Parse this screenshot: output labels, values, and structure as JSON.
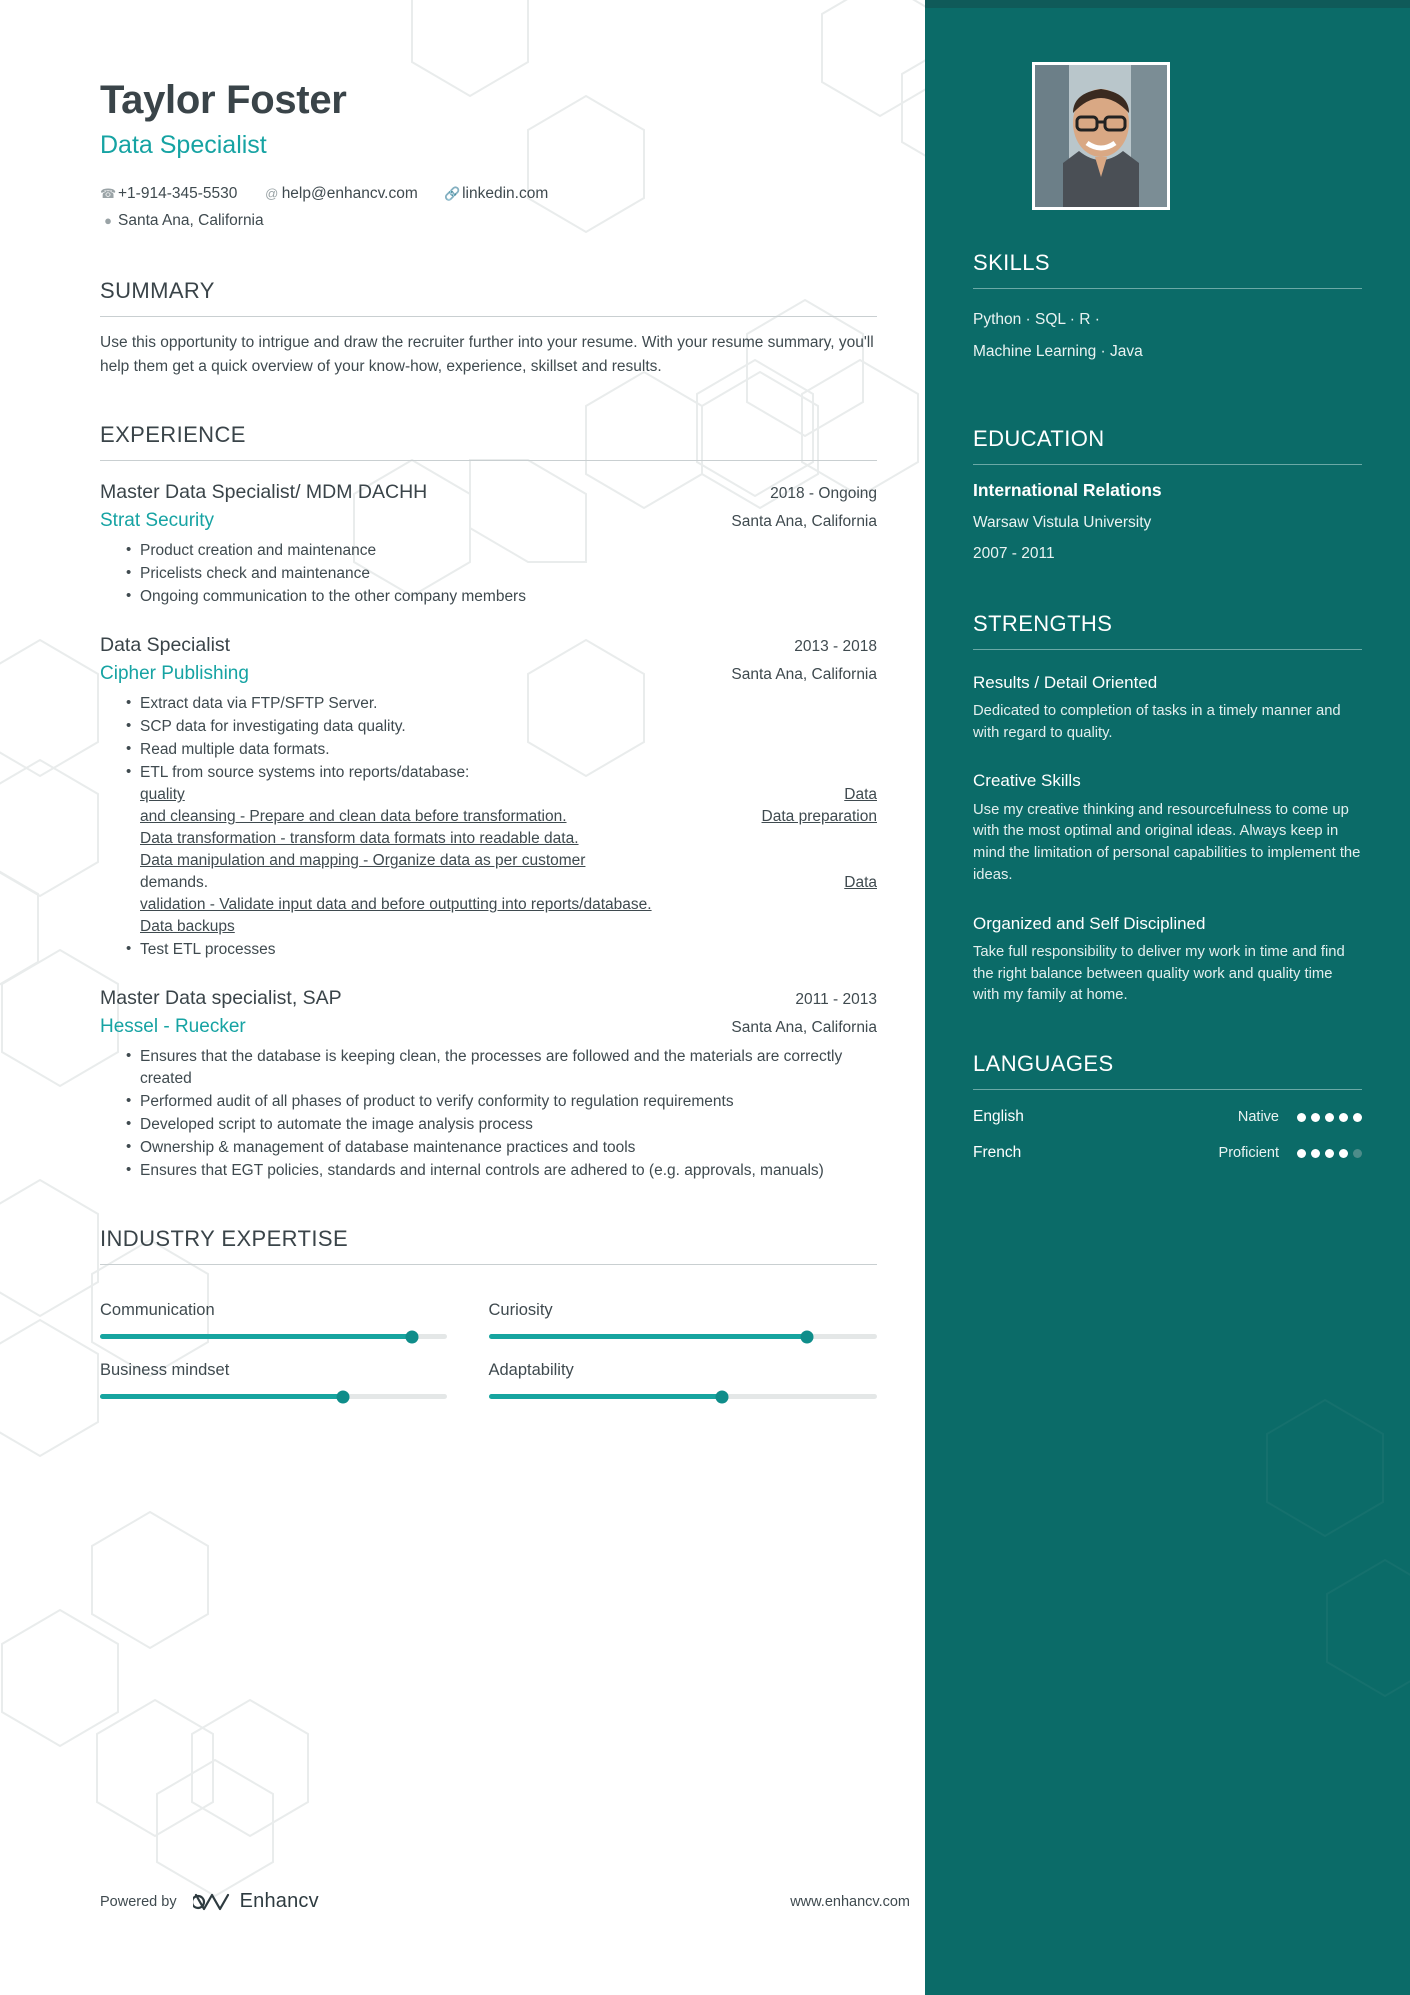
{
  "header": {
    "name": "Taylor Foster",
    "job_title": "Data Specialist",
    "phone": "+1-914-345-5530",
    "email": "help@enhancv.com",
    "linkedin": "linkedin.com",
    "location": "Santa Ana, California"
  },
  "summary": {
    "title": "SUMMARY",
    "text": "Use this opportunity to intrigue and draw the recruiter further into your resume. With your resume summary, you'll help them get a quick overview of your know-how, experience, skillset and results."
  },
  "experience": {
    "title": "EXPERIENCE",
    "jobs": [
      {
        "role": "Master Data Specialist/ MDM DACHH",
        "date": "2018 - Ongoing",
        "company": "Strat Security",
        "location": "Santa Ana, California",
        "bullets": [
          "Product creation and maintenance",
          "Pricelists check and maintenance",
          "Ongoing communication to the other company members"
        ]
      },
      {
        "role": "Data Specialist",
        "date": "2013 - 2018",
        "company": "Cipher Publishing",
        "location": "Santa Ana, California",
        "bullets": [
          "Extract data via FTP/SFTP Server.",
          "SCP data for investigating data quality.",
          "Read multiple data formats."
        ],
        "etl": {
          "lead": "ETL from source systems into reports/database:",
          "line1_left": "quality",
          "line1_right": "Data",
          "line2_left": "and cleansing - Prepare and clean data before transformation.",
          "line2_right": "Data preparation",
          "line3": "Data transformation - transform data formats into readable data.",
          "line4": "Data manipulation and mapping - Organize data as per customer",
          "line5_left": "demands.",
          "line5_right": "Data",
          "line6": "validation - Validate input data and before outputting into reports/database.",
          "line7": "Data backups"
        },
        "bullets_after": [
          "Test ETL processes"
        ]
      },
      {
        "role": "Master Data specialist, SAP",
        "date": "2011 - 2013",
        "company": "Hessel - Ruecker",
        "location": "Santa Ana, California",
        "bullets": [
          "Ensures that the database is keeping clean, the processes are followed and the materials are correctly created",
          "Performed audit of all phases of product to verify conformity to regulation requirements",
          "Developed script to automate the image analysis process",
          "Ownership & management of database maintenance practices and tools",
          "Ensures that EGT policies, standards and internal controls are adhered to (e.g. approvals, manuals)"
        ]
      }
    ]
  },
  "industry_expertise": {
    "title": "INDUSTRY EXPERTISE",
    "items": [
      {
        "label": "Communication",
        "value": 90
      },
      {
        "label": "Curiosity",
        "value": 82
      },
      {
        "label": "Business mindset",
        "value": 70
      },
      {
        "label": "Adaptability",
        "value": 60
      }
    ]
  },
  "footer": {
    "powered_by": "Powered by",
    "brand": "Enhancv",
    "website": "www.enhancv.com"
  },
  "sidebar": {
    "skills": {
      "title": "SKILLS",
      "lines": [
        "Python · SQL ·  R  ·",
        "Machine Learning · Java"
      ]
    },
    "education": {
      "title": "EDUCATION",
      "degree": "International Relations",
      "school": "Warsaw Vistula University",
      "years": "2007 - 2011"
    },
    "strengths": {
      "title": "STRENGTHS",
      "items": [
        {
          "title": "Results / Detail Oriented",
          "desc": "Dedicated to completion of tasks in a timely manner and with regard to quality."
        },
        {
          "title": "Creative Skills",
          "desc": "Use my creative thinking and resourcefulness to come up with the most optimal and original ideas. Always keep in mind the limitation of personal capabilities to implement the ideas."
        },
        {
          "title": "Organized and Self Disciplined",
          "desc": "Take full responsibility to deliver my work in time and find the right balance between quality work and quality time with my family at home."
        }
      ]
    },
    "languages": {
      "title": "LANGUAGES",
      "items": [
        {
          "name": "English",
          "level": "Native",
          "filled": 5,
          "total": 5
        },
        {
          "name": "French",
          "level": "Proficient",
          "filled": 4,
          "total": 5
        }
      ]
    }
  },
  "colors": {
    "accent": "#16a3a3",
    "sidebar_bg": "#0b6b68",
    "text": "#3f4a4f",
    "heading": "#3a4449"
  },
  "icons": {
    "phone": "phone-icon",
    "email": "at-icon",
    "link": "link-icon",
    "pin": "location-pin-icon"
  }
}
